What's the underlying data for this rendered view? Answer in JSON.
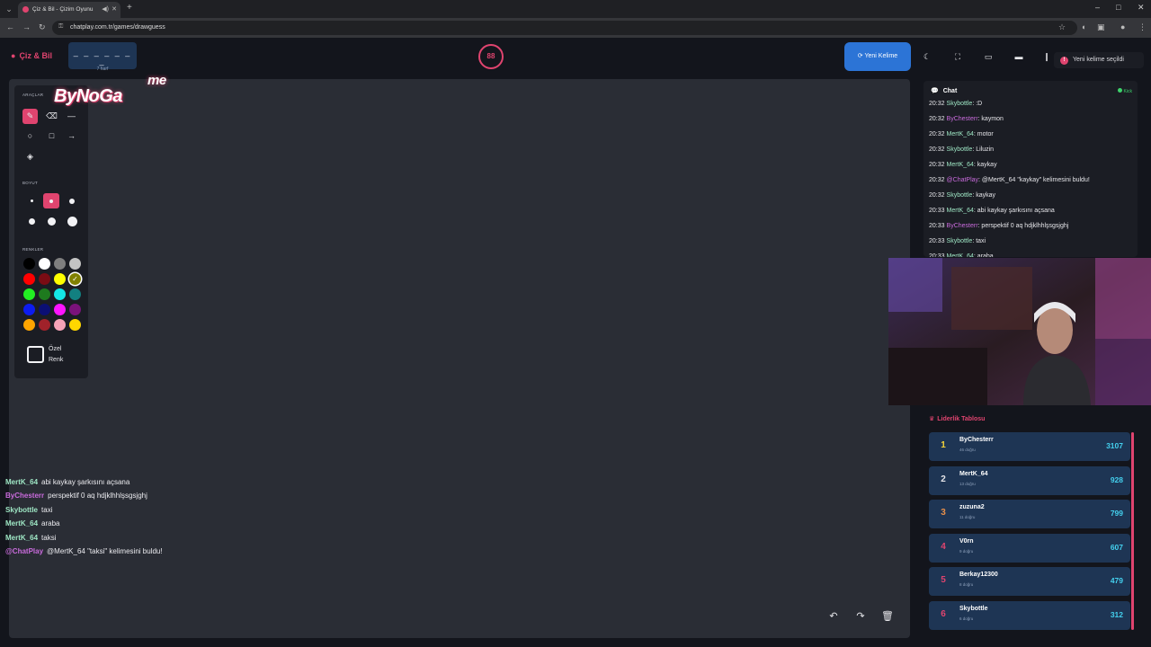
{
  "browser": {
    "tab_title": "Çiz & Bil - Çizim Oyunu",
    "url": "chatplay.com.tr/games/drawguess"
  },
  "header": {
    "brand": "Çiz & Bil",
    "word_blanks": "_ _ _ _ _ _ _",
    "word_hint": "7 harf",
    "timer": "88",
    "new_word_label": "Yeni Kelime",
    "toast": "Yeni kelime seçildi"
  },
  "tools": {
    "tools_label": "ARAÇLAR",
    "size_label": "BOYUT",
    "colors_label": "RENKLER",
    "custom_color_line1": "Özel",
    "custom_color_line2": "Renk",
    "colors": [
      "#000000",
      "#ffffff",
      "#7f7f7f",
      "#c3c3c3",
      "#ff0000",
      "#7a0c14",
      "#ffff00",
      "#808000",
      "#22ee22",
      "#1e7a1e",
      "#14e6e6",
      "#128080",
      "#0d1cee",
      "#0b0f74",
      "#ff14ff",
      "#7a127a",
      "#ffa500",
      "#a0222a",
      "#f6a3b8",
      "#ffd700"
    ],
    "selected_color": 7,
    "selected_size": 1
  },
  "watermark": {
    "logo_text": "ByNoGa",
    "logo_tail": "me"
  },
  "overlay_chat": [
    {
      "user": "MertK_64",
      "text": "abi kaykay şarkısını açsana",
      "color": "#9ee6c4"
    },
    {
      "user": "ByChesterr",
      "text": "perspektif 0 aq hdjklhhlşsgsjghj",
      "color": "#c96bdc"
    },
    {
      "user": "Skybottle",
      "text": "taxi",
      "color": "#9ee6c4"
    },
    {
      "user": "MertK_64",
      "text": "araba",
      "color": "#9ee6c4"
    },
    {
      "user": "MertK_64",
      "text": "taksi",
      "color": "#9ee6c4"
    },
    {
      "user": "@ChatPlay",
      "text": "@MertK_64 \"taksi\" kelimesini buldu!",
      "color": "#c96bdc"
    }
  ],
  "chat": {
    "title": "Chat",
    "platform": "Kick",
    "messages": [
      {
        "time": "20:32",
        "user": "Skybottle",
        "text": ":D",
        "color": "#9ee6c4"
      },
      {
        "time": "20:32",
        "user": "ByChesterr",
        "text": "kaymon",
        "color": "#c96bdc"
      },
      {
        "time": "20:32",
        "user": "MertK_64",
        "text": "motor",
        "color": "#9ee6c4"
      },
      {
        "time": "20:32",
        "user": "Skybottle",
        "text": "Liluzin",
        "color": "#9ee6c4"
      },
      {
        "time": "20:32",
        "user": "MertK_64",
        "text": "kaykay",
        "color": "#9ee6c4"
      },
      {
        "time": "20:32",
        "user": "@ChatPlay",
        "text": "@MertK_64 \"kaykay\" kelimesini buldu!",
        "color": "#c96bdc"
      },
      {
        "time": "20:32",
        "user": "Skybottle",
        "text": "kaykay",
        "color": "#9ee6c4"
      },
      {
        "time": "20:33",
        "user": "MertK_64",
        "text": "abi kaykay şarkısını açsana",
        "color": "#9ee6c4"
      },
      {
        "time": "20:33",
        "user": "ByChesterr",
        "text": "perspektif 0 aq hdjklhhlşsgsjghj",
        "color": "#c96bdc"
      },
      {
        "time": "20:33",
        "user": "Skybottle",
        "text": "taxi",
        "color": "#9ee6c4"
      },
      {
        "time": "20:33",
        "user": "MertK_64",
        "text": "araba",
        "color": "#9ee6c4"
      }
    ]
  },
  "leaderboard": {
    "title": "Liderlik Tablosu",
    "rows": [
      {
        "rank": "1",
        "name": "ByChesterr",
        "sub": "46 doğru",
        "score": "3107",
        "rank_color": "#f2d23a"
      },
      {
        "rank": "2",
        "name": "MertK_64",
        "sub": "13 doğru",
        "score": "928",
        "rank_color": "#e6e6ea"
      },
      {
        "rank": "3",
        "name": "zuzuna2",
        "sub": "11 doğru",
        "score": "799",
        "rank_color": "#e8904a"
      },
      {
        "rank": "4",
        "name": "V0rn",
        "sub": "9 doğru",
        "score": "607",
        "rank_color": "#e0446f"
      },
      {
        "rank": "5",
        "name": "Berkay12300",
        "sub": "8 doğru",
        "score": "479",
        "rank_color": "#e0446f"
      },
      {
        "rank": "6",
        "name": "Skybottle",
        "sub": "6 doğru",
        "score": "312",
        "rank_color": "#e0446f"
      }
    ]
  }
}
